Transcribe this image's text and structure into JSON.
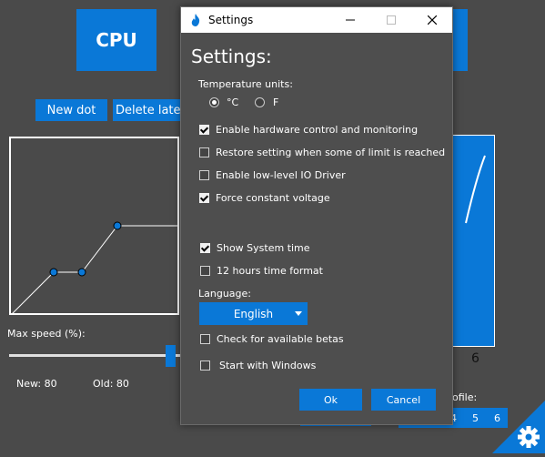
{
  "main": {
    "cpu_label": "CPU",
    "new_dot_label": "New dot",
    "delete_latest_label": "Delete latest",
    "max_speed_label": "Max speed (%):",
    "new_value": "New: 80",
    "old_value": "Old: 80",
    "axis_tick": "6",
    "profile_label": "ofile:",
    "profile_numbers": [
      "4",
      "5",
      "6"
    ]
  },
  "dialog": {
    "title": "Settings",
    "heading": "Settings:",
    "temp_units_label": "Temperature units:",
    "unit_c": "°C",
    "unit_f": "F",
    "options": {
      "hw_control": "Enable hardware control and monitoring",
      "restore": "Restore setting when some of limit is reached",
      "io_driver": "Enable low-level IO Driver",
      "const_voltage": "Force constant voltage",
      "show_time": "Show System time",
      "twelve_hour": "12 hours time format",
      "betas": "Check for available betas",
      "start_windows": "Start with Windows"
    },
    "language_label": "Language:",
    "language_value": "English",
    "ok_label": "Ok",
    "cancel_label": "Cancel"
  },
  "colors": {
    "accent": "#0a78d7",
    "background": "#4a4a4a"
  }
}
